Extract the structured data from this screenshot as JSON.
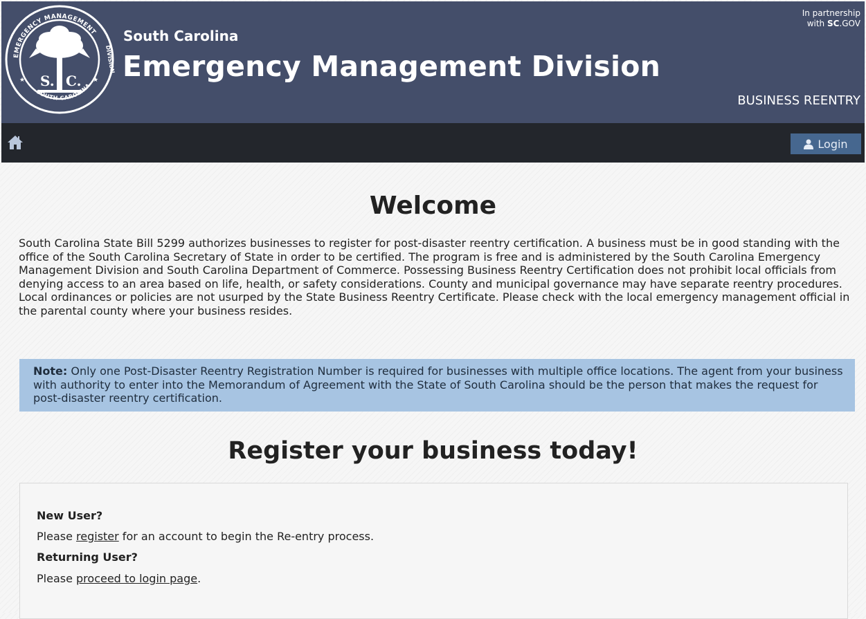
{
  "header": {
    "state": "South Carolina",
    "division": "Emergency Management Division",
    "partner_line1": "In partnership",
    "partner_line2_prefix": "with ",
    "partner_brand_bold": "SC",
    "partner_brand_rest": ".GOV",
    "program": "BUSINESS REENTRY",
    "seal": {
      "top_text": "EMERGENCY MANAGEMENT",
      "right_text": "DIVISION",
      "bottom_text": "SOUTH CAROLINA",
      "initials_left": "S.",
      "initials_right": "C."
    }
  },
  "nav": {
    "home_icon": "home-icon",
    "login_icon": "user-icon",
    "login_label": "Login"
  },
  "main": {
    "welcome_title": "Welcome",
    "intro": "South Carolina State Bill 5299 authorizes businesses to register for post-disaster reentry certification. A business must be in good standing with the office of the South Carolina Secretary of State in order to be certified. The program is free and is administered by the South Carolina Emergency Management Division and South Carolina Department of Commerce. Possessing Business Reentry Certification does not prohibit local officials from denying access to an area based on life, health, or safety considerations. County and municipal governance may have separate reentry procedures. Local ordinances or policies are not usurped by the State Business Reentry Certificate. Please check with the local emergency management official in the parental county where your business resides.",
    "note_label": "Note:",
    "note_text": " Only one Post-Disaster Reentry Registration Number is required for businesses with multiple office locations. The agent from your business with authority to enter into the Memorandum of Agreement with the State of South Carolina should be the person that makes the request for post-disaster reentry certification.",
    "register_title": "Register your business today!",
    "new_user_label": "New User?",
    "new_user_pre": "Please ",
    "new_user_link": "register",
    "new_user_post": " for an account to begin the Re-entry process.",
    "returning_label": "Returning User?",
    "returning_pre": "Please ",
    "returning_link": "proceed to login page",
    "returning_post": "."
  },
  "colors": {
    "header_bg": "#444e6a",
    "navbar_bg": "#23262c",
    "login_bg": "#46678f",
    "note_bg": "#a7c4e2"
  }
}
